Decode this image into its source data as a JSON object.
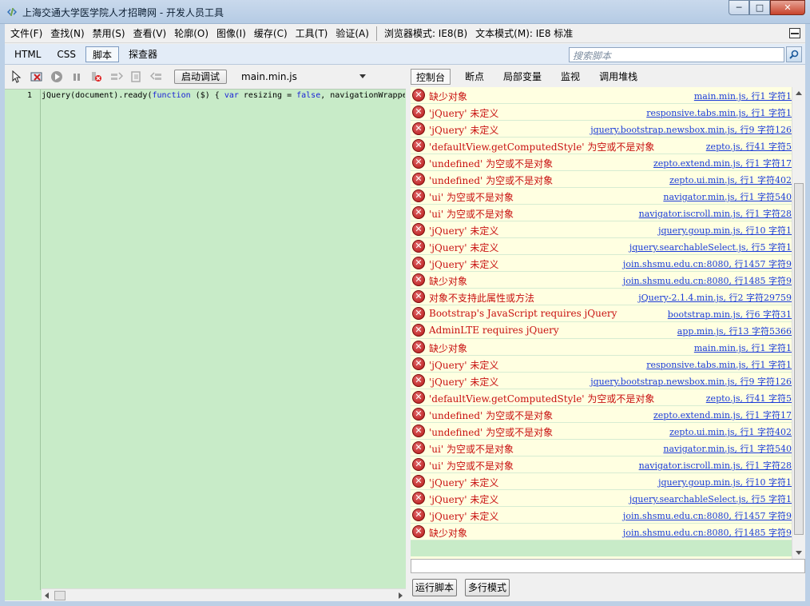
{
  "window": {
    "title": "上海交通大学医学院人才招聘网 - 开发人员工具",
    "min": "─",
    "max": "□",
    "close": "✕"
  },
  "menu": {
    "items": [
      "文件(F)",
      "查找(N)",
      "禁用(S)",
      "查看(V)",
      "轮廓(O)",
      "图像(I)",
      "缓存(C)",
      "工具(T)",
      "验证(A)"
    ],
    "browser_mode": "浏览器模式: IE8(B)",
    "doc_mode": "文本模式(M): IE8 标准"
  },
  "tabs": [
    "HTML",
    "CSS",
    "脚本",
    "探查器"
  ],
  "search": {
    "placeholder": "搜索脚本"
  },
  "toolbar": {
    "start_debug": "启动调试",
    "file": "main.min.js"
  },
  "right_tabs": [
    "控制台",
    "断点",
    "局部变量",
    "监视",
    "调用堆栈"
  ],
  "editor": {
    "line_number": "1",
    "code_parts": [
      "jQuery(document).ready(",
      "function",
      " ($) { ",
      "var",
      " resizing = ",
      "false",
      ", navigationWrapper = $('.cd-main-nav-wr"
    ]
  },
  "console": [
    {
      "msg": "缺少对象",
      "loc": "main.min.js, 行1 字符1"
    },
    {
      "msg": "'jQuery' 未定义",
      "loc": "responsive.tabs.min.js, 行1 字符1"
    },
    {
      "msg": "'jQuery' 未定义",
      "loc": "jquery.bootstrap.newsbox.min.js, 行9 字符126"
    },
    {
      "msg": "'defaultView.getComputedStyle' 为空或不是对象",
      "loc": "zepto.js, 行41 字符5"
    },
    {
      "msg": "'undefined' 为空或不是对象",
      "loc": "zepto.extend.min.js, 行1 字符17"
    },
    {
      "msg": "'undefined' 为空或不是对象",
      "loc": "zepto.ui.min.js, 行1 字符402"
    },
    {
      "msg": "'ui' 为空或不是对象",
      "loc": "navigator.min.js, 行1 字符540"
    },
    {
      "msg": "'ui' 为空或不是对象",
      "loc": "navigator.iscroll.min.js, 行1 字符28"
    },
    {
      "msg": "'jQuery' 未定义",
      "loc": "jquery.goup.min.js, 行10 字符1"
    },
    {
      "msg": "'jQuery' 未定义",
      "loc": "jquery.searchableSelect.js, 行5 字符1"
    },
    {
      "msg": "'jQuery' 未定义",
      "loc": "join.shsmu.edu.cn:8080, 行1457 字符9"
    },
    {
      "msg": "缺少对象",
      "loc": "join.shsmu.edu.cn:8080, 行1485 字符9"
    },
    {
      "msg": "对象不支持此属性或方法",
      "loc": "jQuery-2.1.4.min.js, 行2 字符29759"
    },
    {
      "msg": "Bootstrap's JavaScript requires jQuery",
      "loc": "bootstrap.min.js, 行6 字符31"
    },
    {
      "msg": "AdminLTE requires jQuery",
      "loc": "app.min.js, 行13 字符5366"
    },
    {
      "msg": "缺少对象",
      "loc": "main.min.js, 行1 字符1"
    },
    {
      "msg": "'jQuery' 未定义",
      "loc": "responsive.tabs.min.js, 行1 字符1"
    },
    {
      "msg": "'jQuery' 未定义",
      "loc": "jquery.bootstrap.newsbox.min.js, 行9 字符126"
    },
    {
      "msg": "'defaultView.getComputedStyle' 为空或不是对象",
      "loc": "zepto.js, 行41 字符5"
    },
    {
      "msg": "'undefined' 为空或不是对象",
      "loc": "zepto.extend.min.js, 行1 字符17"
    },
    {
      "msg": "'undefined' 为空或不是对象",
      "loc": "zepto.ui.min.js, 行1 字符402"
    },
    {
      "msg": "'ui' 为空或不是对象",
      "loc": "navigator.min.js, 行1 字符540"
    },
    {
      "msg": "'ui' 为空或不是对象",
      "loc": "navigator.iscroll.min.js, 行1 字符28"
    },
    {
      "msg": "'jQuery' 未定义",
      "loc": "jquery.goup.min.js, 行10 字符1"
    },
    {
      "msg": "'jQuery' 未定义",
      "loc": "jquery.searchableSelect.js, 行5 字符1"
    },
    {
      "msg": "'jQuery' 未定义",
      "loc": "join.shsmu.edu.cn:8080, 行1457 字符9"
    },
    {
      "msg": "缺少对象",
      "loc": "join.shsmu.edu.cn:8080, 行1485 字符9"
    }
  ],
  "buttons": {
    "run_script": "运行脚本",
    "multiline": "多行模式"
  }
}
